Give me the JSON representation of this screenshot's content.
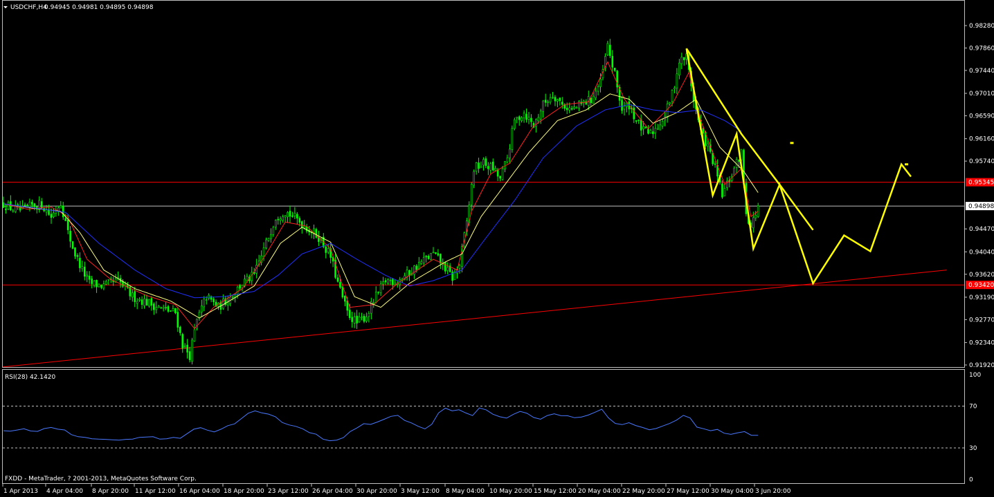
{
  "header": {
    "symbol": "USDCHF,H4",
    "ohlc": "0.94945 0.94981 0.94895 0.94898"
  },
  "indicator_header": "RSI(28) 42.1420",
  "copyright": "FXDD - MetaTrader, ? 2001-2013, MetaQuotes Software Corp.",
  "colors": {
    "background": "#000000",
    "frame": "#c0c0c0",
    "bull_candle": "#00ff00",
    "bear_candle": "#00a000",
    "ma_fast": "#ff2020",
    "ma_mid": "#ffff80",
    "ma_slow": "#2030ff",
    "hline": "#ff0000",
    "trendline": "#ff0000",
    "drawing": "#ffff00",
    "rsi": "#4a78ff",
    "bid_line": "#c0c0c0"
  },
  "chart_data": [
    {
      "type": "candlestick",
      "title": "USDCHF,H4",
      "x_tick_labels": [
        "1 Apr 2013",
        "4 Apr 04:00",
        "8 Apr 20:00",
        "11 Apr 12:00",
        "16 Apr 04:00",
        "18 Apr 20:00",
        "23 Apr 12:00",
        "26 Apr 04:00",
        "30 Apr 20:00",
        "3 May 12:00",
        "8 May 04:00",
        "10 May 20:00",
        "15 May 12:00",
        "20 May 04:00",
        "22 May 20:00",
        "27 May 12:00",
        "30 May 04:00",
        "3 Jun 20:00"
      ],
      "y_tick_labels": [
        "0.98280",
        "0.97860",
        "0.97440",
        "0.97010",
        "0.96590",
        "0.96160",
        "0.95740",
        "0.94470",
        "0.94040",
        "0.93620",
        "0.93190",
        "0.92770",
        "0.92340",
        "0.91920"
      ],
      "ylim": [
        0.919,
        0.9845
      ],
      "price_labels": {
        "upper_resistance": "0.95345",
        "current_bid": "0.94898",
        "lower_support": "0.93420"
      },
      "horizontal_lines": [
        0.95345,
        0.9342
      ],
      "bid": 0.94898,
      "close_path": [
        [
          0,
          0.9494
        ],
        [
          4,
          0.9484
        ],
        [
          8,
          0.9481
        ],
        [
          12,
          0.9491
        ],
        [
          16,
          0.9493
        ],
        [
          20,
          0.947
        ],
        [
          24,
          0.9497
        ],
        [
          27,
          0.944
        ],
        [
          30,
          0.94
        ],
        [
          33,
          0.937
        ],
        [
          36,
          0.9345
        ],
        [
          42,
          0.934
        ],
        [
          48,
          0.935
        ],
        [
          54,
          0.932
        ],
        [
          60,
          0.931
        ],
        [
          66,
          0.9298
        ],
        [
          72,
          0.929
        ],
        [
          75,
          0.923
        ],
        [
          78,
          0.921
        ],
        [
          81,
          0.9275
        ],
        [
          85,
          0.932
        ],
        [
          90,
          0.93
        ],
        [
          95,
          0.932
        ],
        [
          100,
          0.9345
        ],
        [
          105,
          0.936
        ],
        [
          110,
          0.942
        ],
        [
          114,
          0.947
        ],
        [
          118,
          0.948
        ],
        [
          122,
          0.9468
        ],
        [
          127,
          0.945
        ],
        [
          132,
          0.9432
        ],
        [
          137,
          0.9395
        ],
        [
          140,
          0.9345
        ],
        [
          144,
          0.929
        ],
        [
          148,
          0.927
        ],
        [
          152,
          0.9285
        ],
        [
          156,
          0.932
        ],
        [
          160,
          0.935
        ],
        [
          165,
          0.935
        ],
        [
          170,
          0.9365
        ],
        [
          175,
          0.9385
        ],
        [
          180,
          0.94
        ],
        [
          184,
          0.938
        ],
        [
          188,
          0.9355
        ],
        [
          191,
          0.938
        ],
        [
          194,
          0.946
        ],
        [
          197,
          0.956
        ],
        [
          201,
          0.957
        ],
        [
          205,
          0.956
        ],
        [
          208,
          0.954
        ],
        [
          211,
          0.958
        ],
        [
          214,
          0.965
        ],
        [
          218,
          0.9665
        ],
        [
          222,
          0.964
        ],
        [
          226,
          0.968
        ],
        [
          230,
          0.97
        ],
        [
          234,
          0.968
        ],
        [
          238,
          0.967
        ],
        [
          242,
          0.968
        ],
        [
          246,
          0.969
        ],
        [
          250,
          0.972
        ],
        [
          253,
          0.979
        ],
        [
          256,
          0.9735
        ],
        [
          259,
          0.967
        ],
        [
          262,
          0.968
        ],
        [
          265,
          0.965
        ],
        [
          268,
          0.963
        ],
        [
          271,
          0.9625
        ],
        [
          274,
          0.964
        ],
        [
          277,
          0.966
        ],
        [
          280,
          0.97
        ],
        [
          283,
          0.976
        ],
        [
          286,
          0.977
        ],
        [
          289,
          0.969
        ],
        [
          292,
          0.963
        ],
        [
          295,
          0.96
        ],
        [
          298,
          0.956
        ],
        [
          301,
          0.951
        ],
        [
          304,
          0.954
        ],
        [
          307,
          0.957
        ],
        [
          309,
          0.959
        ],
        [
          311,
          0.948
        ],
        [
          313,
          0.945
        ],
        [
          316,
          0.949
        ]
      ],
      "series": [
        {
          "name": "",
          "kind": "moving_average",
          "path": [
            [
              0,
              0.9494
            ],
            [
              10,
              0.9484
            ],
            [
              20,
              0.9488
            ],
            [
              27,
              0.947
            ],
            [
              35,
              0.939
            ],
            [
              45,
              0.9352
            ],
            [
              60,
              0.9322
            ],
            [
              72,
              0.9305
            ],
            [
              80,
              0.926
            ],
            [
              88,
              0.93
            ],
            [
              100,
              0.9335
            ],
            [
              110,
              0.94
            ],
            [
              118,
              0.946
            ],
            [
              127,
              0.9452
            ],
            [
              137,
              0.941
            ],
            [
              145,
              0.93
            ],
            [
              155,
              0.9305
            ],
            [
              165,
              0.9345
            ],
            [
              180,
              0.939
            ],
            [
              190,
              0.937
            ],
            [
              196,
              0.948
            ],
            [
              204,
              0.955
            ],
            [
              212,
              0.957
            ],
            [
              222,
              0.964
            ],
            [
              235,
              0.968
            ],
            [
              245,
              0.9685
            ],
            [
              253,
              0.976
            ],
            [
              260,
              0.969
            ],
            [
              270,
              0.9635
            ],
            [
              280,
              0.968
            ],
            [
              287,
              0.974
            ],
            [
              292,
              0.965
            ],
            [
              302,
              0.953
            ],
            [
              309,
              0.956
            ],
            [
              313,
              0.947
            ],
            [
              316,
              0.948
            ]
          ]
        },
        {
          "name": "",
          "kind": "moving_average",
          "path": [
            [
              0,
              0.9494
            ],
            [
              12,
              0.9486
            ],
            [
              24,
              0.948
            ],
            [
              32,
              0.944
            ],
            [
              42,
              0.937
            ],
            [
              55,
              0.9335
            ],
            [
              70,
              0.9312
            ],
            [
              82,
              0.928
            ],
            [
              92,
              0.9305
            ],
            [
              105,
              0.934
            ],
            [
              116,
              0.942
            ],
            [
              125,
              0.945
            ],
            [
              137,
              0.9422
            ],
            [
              147,
              0.932
            ],
            [
              158,
              0.93
            ],
            [
              170,
              0.9345
            ],
            [
              185,
              0.9385
            ],
            [
              192,
              0.94
            ],
            [
              200,
              0.947
            ],
            [
              210,
              0.953
            ],
            [
              220,
              0.959
            ],
            [
              232,
              0.965
            ],
            [
              244,
              0.967
            ],
            [
              254,
              0.97
            ],
            [
              262,
              0.969
            ],
            [
              272,
              0.9645
            ],
            [
              282,
              0.9665
            ],
            [
              290,
              0.969
            ],
            [
              300,
              0.96
            ],
            [
              310,
              0.9555
            ],
            [
              316,
              0.9515
            ]
          ]
        },
        {
          "name": "",
          "kind": "moving_average",
          "path": [
            [
              0,
              0.9494
            ],
            [
              15,
              0.9485
            ],
            [
              26,
              0.9478
            ],
            [
              40,
              0.942
            ],
            [
              55,
              0.937
            ],
            [
              68,
              0.9335
            ],
            [
              80,
              0.9318
            ],
            [
              92,
              0.932
            ],
            [
              105,
              0.933
            ],
            [
              115,
              0.936
            ],
            [
              125,
              0.94
            ],
            [
              137,
              0.942
            ],
            [
              148,
              0.939
            ],
            [
              160,
              0.936
            ],
            [
              170,
              0.934
            ],
            [
              180,
              0.935
            ],
            [
              192,
              0.937
            ],
            [
              202,
              0.943
            ],
            [
              214,
              0.95
            ],
            [
              226,
              0.958
            ],
            [
              240,
              0.964
            ],
            [
              252,
              0.967
            ],
            [
              262,
              0.968
            ],
            [
              272,
              0.967
            ],
            [
              282,
              0.9665
            ],
            [
              292,
              0.967
            ],
            [
              302,
              0.965
            ],
            [
              309,
              0.963
            ]
          ]
        }
      ],
      "trendline": {
        "from": [
          -40,
          0.917
        ],
        "to": [
          395,
          0.937
        ]
      },
      "projection": {
        "path": [
          [
            286,
            0.9785
          ],
          [
            297,
            0.951
          ],
          [
            307,
            0.9625
          ],
          [
            314,
            0.941
          ],
          [
            325,
            0.953
          ],
          [
            339,
            0.9345
          ],
          [
            352,
            0.9435
          ],
          [
            363,
            0.9405
          ],
          [
            376,
            0.9568
          ],
          [
            380,
            0.9545
          ]
        ],
        "channel_upper": [
          [
            286,
            0.9785
          ],
          [
            309,
            0.9625
          ],
          [
            325,
            0.953
          ],
          [
            339,
            0.9445
          ]
        ],
        "dots": [
          [
            330,
            0.9608
          ],
          [
            378,
            0.9568
          ]
        ]
      }
    },
    {
      "type": "line",
      "title": "RSI(28) 42.1420",
      "ylim": [
        0,
        100
      ],
      "y_tick_labels": [
        "100",
        "70",
        "30",
        "0"
      ],
      "levels": [
        70,
        30
      ],
      "values": [
        46.5,
        46.0,
        47.1,
        48.3,
        46.2,
        45.8,
        48.5,
        49.6,
        47.9,
        47.2,
        42.7,
        40.7,
        40.1,
        38.8,
        38.4,
        38.2,
        37.8,
        37.5,
        38.2,
        38.5,
        40.1,
        40.4,
        40.7,
        38.4,
        38.8,
        40.1,
        39.2,
        43.6,
        47.9,
        49.4,
        47.0,
        45.3,
        47.9,
        51.3,
        53.0,
        58.1,
        63.2,
        65.4,
        63.5,
        62.3,
        59.8,
        54.3,
        52.0,
        50.6,
        48.3,
        44.6,
        43.1,
        38.4,
        36.9,
        37.5,
        39.9,
        45.7,
        49.1,
        53.2,
        52.5,
        54.8,
        57.4,
        60.2,
        61.1,
        56.3,
        53.9,
        50.7,
        48.2,
        52.6,
        63.5,
        68.0,
        65.4,
        66.5,
        63.4,
        60.9,
        68.2,
        66.4,
        62.2,
        59.8,
        58.5,
        62.1,
        64.9,
        63.1,
        59.1,
        57.4,
        61.0,
        62.6,
        60.8,
        60.7,
        58.9,
        59.5,
        61.4,
        64.1,
        67.0,
        58.6,
        53.4,
        52.3,
        54.1,
        51.4,
        49.6,
        47.4,
        48.6,
        51.0,
        53.4,
        56.6,
        61.1,
        58.6,
        49.9,
        48.3,
        46.5,
        47.7,
        44.1,
        43.0,
        44.5,
        45.6,
        42.1,
        42.1
      ]
    }
  ]
}
